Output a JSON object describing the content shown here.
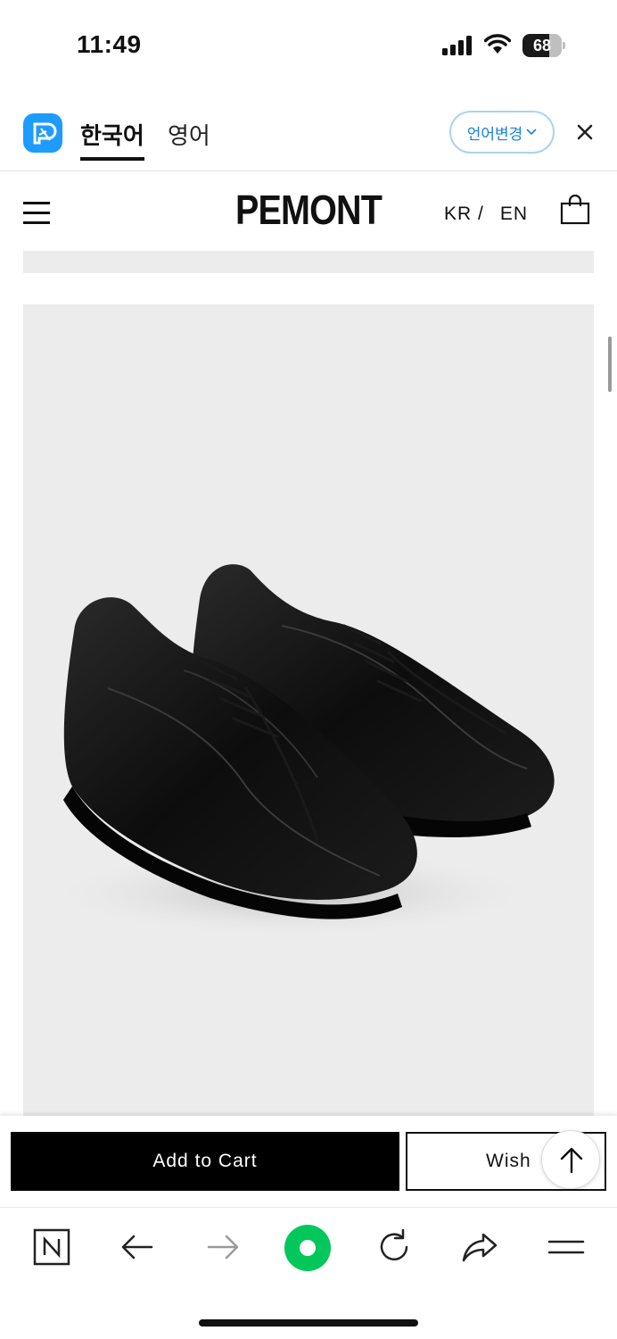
{
  "status_bar": {
    "time": "11:49",
    "battery_level": "68",
    "icons": [
      "cellular-signal-icon",
      "wifi-icon",
      "battery-icon"
    ]
  },
  "translate_bar": {
    "logo_icon": "papago-logo-icon",
    "tabs": [
      {
        "label": "한국어",
        "active": true
      },
      {
        "label": "영어",
        "active": false
      }
    ],
    "change_language_label": "언어변경",
    "close_icon": "close-icon",
    "accent_color": "#1e9bff"
  },
  "header": {
    "brand": "PEMONT",
    "lang_kr": "KR /",
    "lang_en": "EN",
    "menu_icon": "hamburger-icon",
    "cart_icon": "shopping-bag-icon"
  },
  "product": {
    "image_icon": "black-sneakers-image"
  },
  "actions": {
    "add_to_cart_label": "Add to Cart",
    "wish_label": "Wish",
    "scroll_top_icon": "arrow-up-icon"
  },
  "browser_toolbar": {
    "items": [
      "naver-n-icon",
      "back-arrow-icon",
      "forward-arrow-icon",
      "green-dot-icon",
      "reload-icon",
      "share-icon",
      "menu-icon"
    ],
    "green_color": "#03c75a"
  }
}
